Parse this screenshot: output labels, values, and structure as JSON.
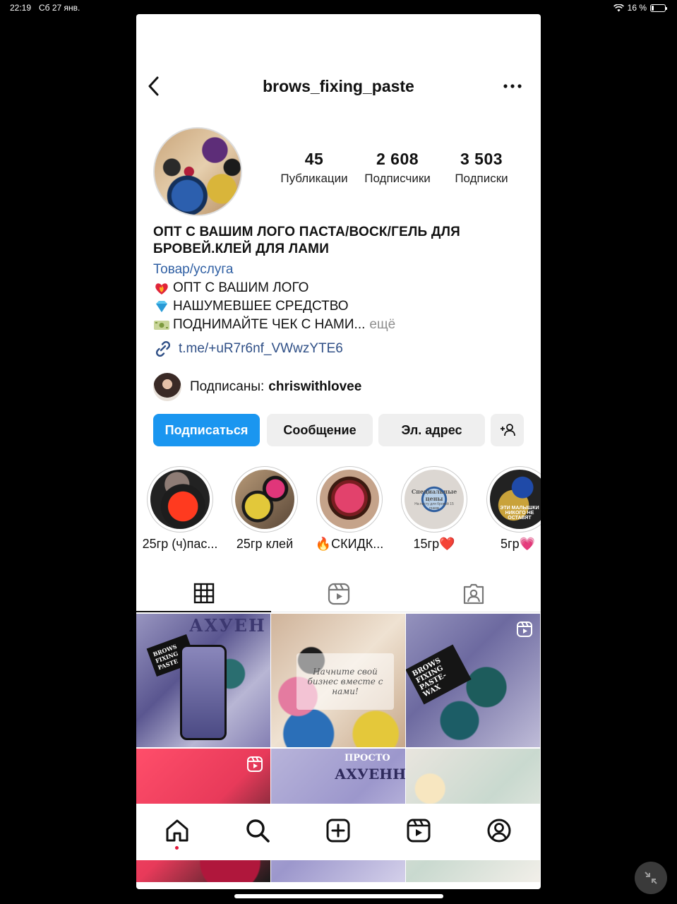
{
  "status_bar": {
    "time": "22:19",
    "date": "Сб 27 янв.",
    "battery": "16 %"
  },
  "profile": {
    "username": "brows_fixing_paste",
    "stats": [
      {
        "value": "45",
        "label": "Публикации"
      },
      {
        "value": "2 608",
        "label": "Подписчики"
      },
      {
        "value": "3 503",
        "label": "Подписки"
      }
    ],
    "bio_name": "ОПТ С ВАШИМ ЛОГО ПАСТА/ВОСК/ГЕЛЬ ДЛЯ БРОВЕЙ.КЛЕЙ ДЛЯ ЛАМИ",
    "category": "Товар/услуга",
    "bio_lines": [
      {
        "emoji": "heart-on-fire-emoji",
        "text": "ОПТ С ВАШИМ ЛОГО"
      },
      {
        "emoji": "gem-emoji",
        "text": "НАШУМЕВШЕЕ СРЕДСТВО"
      },
      {
        "emoji": "money-emoji",
        "text": "ПОДНИМАЙТЕ ЧЕК С НАМИ...",
        "more": "ещё"
      }
    ],
    "link": "t.me/+uR7r6nf_VWwzYTE6",
    "followed_by_prefix": "Подписаны:",
    "followed_by_user": "chriswithlovee"
  },
  "buttons": {
    "follow": "Подписаться",
    "message": "Сообщение",
    "email": "Эл. адрес"
  },
  "highlights": [
    {
      "label": "25гр (ч)пас..."
    },
    {
      "label": "25гр клей"
    },
    {
      "label": "🔥СКИДК..."
    },
    {
      "label": "15гр❤️",
      "cover_text_1": "Специальные цены",
      "cover_text_2": "На пасту для бровей 15 грамм"
    },
    {
      "label": "5гр💗",
      "cover_text": "ЭТИ МАЛЫШКИ НИКОГО НЕ ОСТАВЯТ"
    }
  ],
  "posts": {
    "p1_text": "АХУЕН",
    "p1_card": "BROWS FIXING PASTE",
    "p2_caption": "Начните свой бизнес вместе с нами!",
    "p3_text": "BROWS FIXING PASTE-WAX",
    "p5_text_1": "ПРОСТО",
    "p5_text_2": "АХУЕННО"
  },
  "colors": {
    "primary_button": "#1a96f0",
    "link": "#2f4f86",
    "notification_dot": "#e3163a"
  }
}
